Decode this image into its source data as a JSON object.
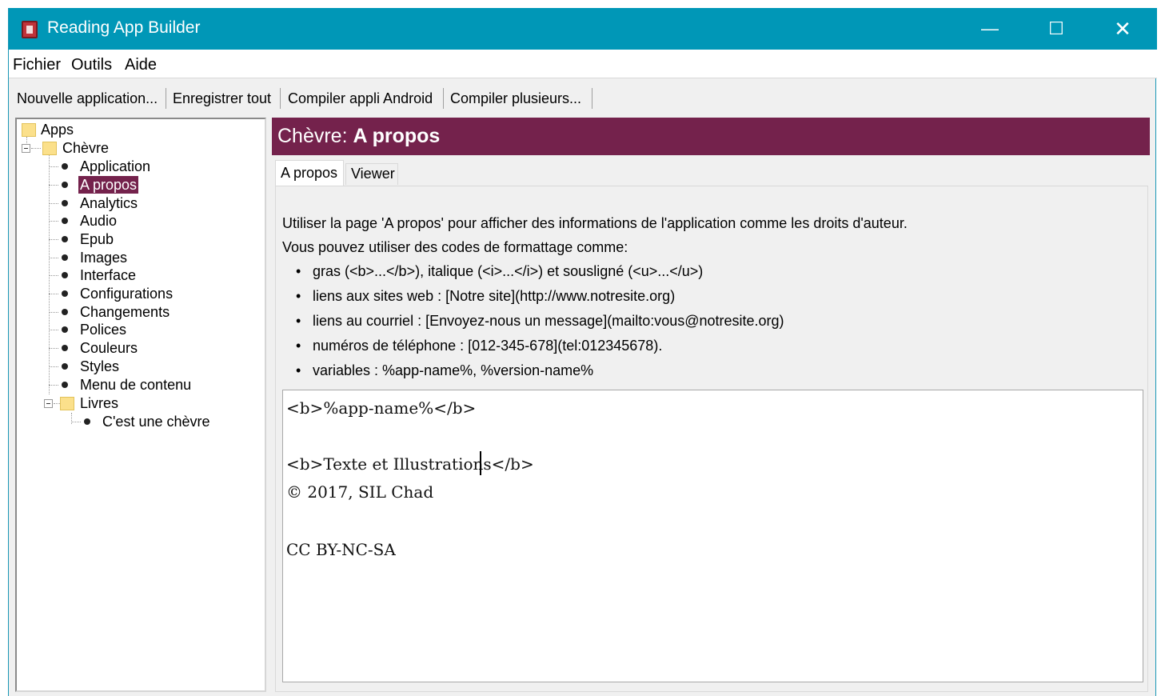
{
  "window": {
    "title": "Reading App Builder",
    "controls": {
      "minimize": "—",
      "maximize": "☐",
      "close": "✕"
    }
  },
  "menu": [
    "Fichier",
    "Outils",
    "Aide"
  ],
  "toolbar": [
    "Nouvelle application...",
    "Enregistrer tout",
    "Compiler appli Android",
    "Compiler plusieurs..."
  ],
  "tree": {
    "root": "Apps",
    "app": "Chèvre",
    "app_items": [
      "Application",
      "A propos",
      "Analytics",
      "Audio",
      "Epub",
      "Images",
      "Interface",
      "Configurations",
      "Changements",
      "Polices",
      "Couleurs",
      "Styles",
      "Menu de contenu"
    ],
    "selected": "A propos",
    "books_folder": "Livres",
    "books": [
      "C'est une chèvre"
    ]
  },
  "panel": {
    "header_prefix": "Chèvre:",
    "header_title": "A propos",
    "tabs": [
      "A propos",
      "Viewer"
    ],
    "active_tab": "A propos"
  },
  "help": {
    "intro": "Utiliser la page 'A propos' pour afficher des informations de l'application comme les droits d'auteur.",
    "formatting_intro": "Vous pouvez utiliser des codes de formattage comme:",
    "bullets": [
      "gras (<b>...</b>), italique (<i>...</i>) et sousligné (<u>...</u>)",
      "liens aux sites web : [Notre site](http://www.notresite.org)",
      "liens au courriel : [Envoyez-nous un message](mailto:vous@notresite.org)",
      "numéros de téléphone : [012-345-678](tel:012345678).",
      "variables : %app-name%, %version-name%"
    ]
  },
  "editor": {
    "lines": [
      "<b>%app-name%</b>",
      "",
      "<b>Texte et Illustrations</b>",
      "© 2017, SIL Chad",
      "",
      "CC BY-NC-SA"
    ]
  },
  "colors": {
    "titlebar": "#0097b7",
    "header": "#74224c",
    "selection": "#74224c"
  }
}
